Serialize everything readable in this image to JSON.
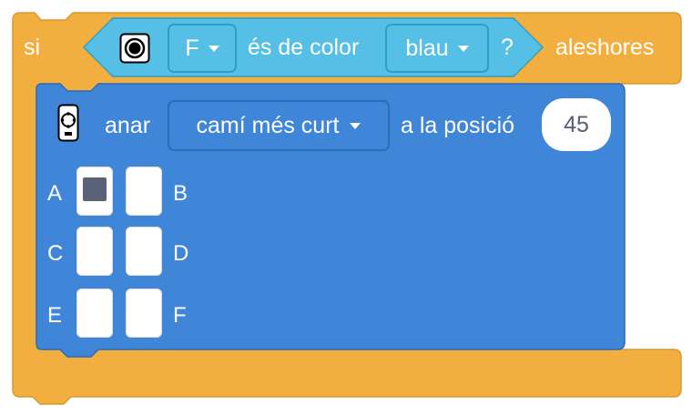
{
  "if_block": {
    "keyword_if": "si",
    "keyword_then": "aleshores",
    "condition": {
      "sensor_icon": "color-sensor-icon",
      "port_value": "F",
      "text_is_color": "és de color",
      "color_value": "blau",
      "question_mark": "?"
    }
  },
  "motor_block": {
    "icon": "motor-icon",
    "text_go": "anar",
    "direction_value": "camí més curt",
    "text_position": "a la posició",
    "position_value": "45",
    "ports": [
      {
        "label": "A",
        "selected": true
      },
      {
        "label": "B",
        "selected": false
      },
      {
        "label": "C",
        "selected": false
      },
      {
        "label": "D",
        "selected": false
      },
      {
        "label": "E",
        "selected": false
      },
      {
        "label": "F",
        "selected": false
      }
    ]
  },
  "colors": {
    "control_orange": "#f2ae3e",
    "sensor_cyan": "#55bfe6",
    "motor_blue": "#3f86d8"
  }
}
